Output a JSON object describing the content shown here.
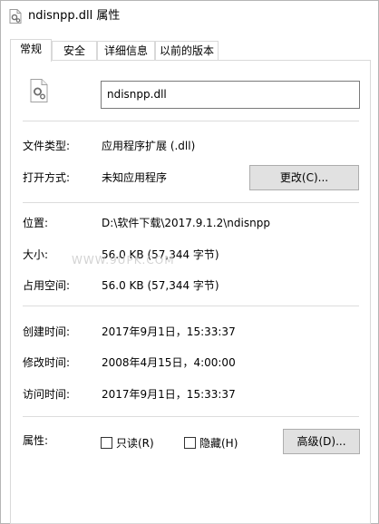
{
  "window": {
    "title": "ndisnpp.dll 属性"
  },
  "tabs": [
    {
      "label": "常规",
      "active": true
    },
    {
      "label": "安全",
      "active": false
    },
    {
      "label": "详细信息",
      "active": false
    },
    {
      "label": "以前的版本",
      "active": false
    }
  ],
  "general": {
    "file_name": "ndisnpp.dll",
    "file_type_label": "文件类型:",
    "file_type_value": "应用程序扩展 (.dll)",
    "open_with_label": "打开方式:",
    "open_with_value": "未知应用程序",
    "change_button": "更改(C)...",
    "location_label": "位置:",
    "location_value": "D:\\软件下载\\2017.9.1.2\\ndisnpp",
    "size_label": "大小:",
    "size_value": "56.0 KB (57,344 字节)",
    "size_on_disk_label": "占用空间:",
    "size_on_disk_value": "56.0 KB (57,344 字节)",
    "created_label": "创建时间:",
    "created_value": "2017年9月1日，15:33:37",
    "modified_label": "修改时间:",
    "modified_value": "2008年4月15日，4:00:00",
    "accessed_label": "访问时间:",
    "accessed_value": "2017年9月1日，15:33:37",
    "attributes_label": "属性:",
    "readonly_label": "只读(R)",
    "readonly_checked": false,
    "hidden_label": "隐藏(H)",
    "hidden_checked": false,
    "advanced_button": "高级(D)..."
  },
  "watermark": "WWW.9UPK.COM",
  "icons": {
    "app": "dll-gear-icon",
    "file": "dll-file-icon"
  }
}
